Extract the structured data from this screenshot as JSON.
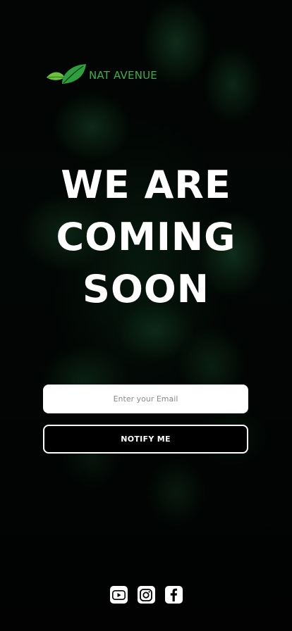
{
  "brand": {
    "name": "NAT AVENUE",
    "color": "#3cb043",
    "logo_icon": "leaf-icon"
  },
  "headline": {
    "line1": "WE ARE",
    "line2": "COMING",
    "line3": "SOON"
  },
  "form": {
    "email_placeholder": "Enter your Email",
    "email_value": "",
    "notify_label": "NOTIFY ME"
  },
  "socials": [
    {
      "name": "YouTube",
      "icon": "youtube-icon"
    },
    {
      "name": "Instagram",
      "icon": "instagram-icon"
    },
    {
      "name": "Facebook",
      "icon": "facebook-icon"
    }
  ]
}
